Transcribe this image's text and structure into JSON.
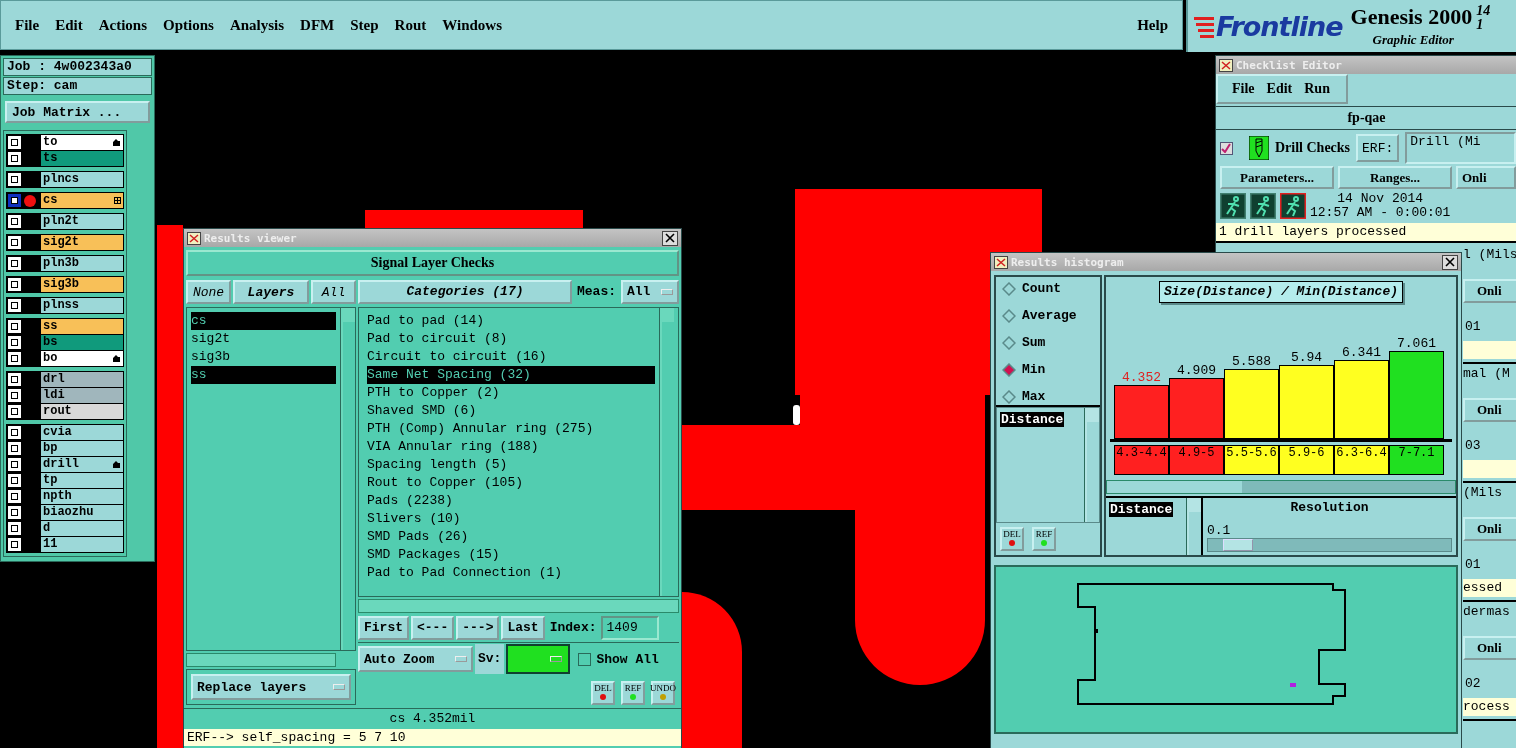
{
  "menu_bar": {
    "items": [
      "File",
      "Edit",
      "Actions",
      "Options",
      "Analysis",
      "DFM",
      "Step",
      "Rout",
      "Windows"
    ],
    "help": "Help"
  },
  "logo": {
    "brand": "Frontline",
    "product": "Genesis 2000",
    "version": "14",
    "version_line2": "1",
    "subtitle": "Graphic Editor"
  },
  "job_panel": {
    "job": "Job : 4w002343a0",
    "step": "Step: cam",
    "matrix_button": "Job Matrix ...",
    "layer_groups": [
      {
        "layers": [
          {
            "name": "to",
            "color": "#ffffff",
            "work_layer": false,
            "pointer_mark": true
          },
          {
            "name": "ts",
            "color": "#109a7c",
            "work_layer": false
          }
        ]
      },
      {
        "layers": [
          {
            "name": "plncs",
            "color": "#9cd8d8",
            "work_layer": false
          }
        ]
      },
      {
        "layers": [
          {
            "name": "cs",
            "color": "#f8c058",
            "work_layer": true,
            "grid_mark": true
          }
        ]
      },
      {
        "layers": [
          {
            "name": "pln2t",
            "color": "#9cd8d8",
            "work_layer": false
          }
        ]
      },
      {
        "layers": [
          {
            "name": "sig2t",
            "color": "#f8c058",
            "work_layer": false
          }
        ]
      },
      {
        "layers": [
          {
            "name": "pln3b",
            "color": "#9cd8d8",
            "work_layer": false
          }
        ]
      },
      {
        "layers": [
          {
            "name": "sig3b",
            "color": "#f8c058",
            "work_layer": false
          }
        ]
      },
      {
        "layers": [
          {
            "name": "plnss",
            "color": "#9cd8d8",
            "work_layer": false
          }
        ]
      },
      {
        "layers": [
          {
            "name": "ss",
            "color": "#f8c058",
            "work_layer": false
          },
          {
            "name": "bs",
            "color": "#109a7c",
            "work_layer": false
          },
          {
            "name": "bo",
            "color": "#ffffff",
            "work_layer": false,
            "pointer_mark": true
          }
        ]
      },
      {
        "layers": [
          {
            "name": "drl",
            "color": "#a0b6bc",
            "work_layer": false
          },
          {
            "name": "ldi",
            "color": "#a0b6bc",
            "work_layer": false
          },
          {
            "name": "rout",
            "color": "#d8d8d8",
            "work_layer": false
          }
        ]
      },
      {
        "layers": [
          {
            "name": "cvia",
            "color": "#9cd8d8",
            "work_layer": false
          },
          {
            "name": "bp",
            "color": "#9cd8d8",
            "work_layer": false
          },
          {
            "name": "drill",
            "color": "#9cd8d8",
            "work_layer": false,
            "pointer_mark": true
          },
          {
            "name": "tp",
            "color": "#9cd8d8",
            "work_layer": false
          },
          {
            "name": "npth",
            "color": "#9cd8d8",
            "work_layer": false
          },
          {
            "name": "biaozhu",
            "color": "#9cd8d8",
            "work_layer": false
          },
          {
            "name": "d",
            "color": "#9cd8d8",
            "work_layer": false
          },
          {
            "name": "11",
            "color": "#9cd8d8",
            "work_layer": false
          }
        ]
      }
    ]
  },
  "results_viewer": {
    "title": "Results viewer",
    "header": "Signal Layer Checks",
    "none_button": "None",
    "layers_button": "Layers",
    "all_button": "All",
    "layers": [
      {
        "name": "cs",
        "selected": true
      },
      {
        "name": "sig2t",
        "selected": false
      },
      {
        "name": "sig3b",
        "selected": false
      },
      {
        "name": "ss",
        "selected": true
      }
    ],
    "categories_button": "Categories (17)",
    "meas_label": "Meas:",
    "meas_value": "All",
    "categories": [
      {
        "name": "Pad to pad (14)",
        "selected": false
      },
      {
        "name": "Pad to circuit (8)",
        "selected": false
      },
      {
        "name": "Circuit to circuit (16)",
        "selected": false
      },
      {
        "name": "Same Net Spacing (32)",
        "selected": true
      },
      {
        "name": "PTH to Copper (2)",
        "selected": false
      },
      {
        "name": "Shaved SMD (6)",
        "selected": false
      },
      {
        "name": "PTH (Comp) Annular ring (275)",
        "selected": false
      },
      {
        "name": "VIA Annular ring (188)",
        "selected": false
      },
      {
        "name": "Spacing length (5)",
        "selected": false
      },
      {
        "name": "Rout to Copper (105)",
        "selected": false
      },
      {
        "name": "Pads (2238)",
        "selected": false
      },
      {
        "name": "Slivers (10)",
        "selected": false
      },
      {
        "name": "SMD Pads (26)",
        "selected": false
      },
      {
        "name": "SMD Packages (15)",
        "selected": false
      },
      {
        "name": "Pad to Pad Connection (1)",
        "selected": false
      }
    ],
    "nav_buttons": [
      "First",
      "<---",
      "--->",
      "Last"
    ],
    "index_label": "Index:",
    "index_value": "1409",
    "zoom_mode": "Auto Zoom",
    "sv_label": "Sv:",
    "sv": {
      "color": "#20e020"
    },
    "show_all": {
      "label": "Show All",
      "checked": false
    },
    "replace_mode": "Replace layers",
    "action_buttons": [
      "DEL",
      "REF",
      "UNDO"
    ],
    "status": "cs 4.352mil",
    "erf_line": "ERF--> self_spacing = 5 7 10"
  },
  "histogram": {
    "title": "Results histogram",
    "modes": [
      {
        "label": "Count",
        "selected": false
      },
      {
        "label": "Average",
        "selected": false
      },
      {
        "label": "Sum",
        "selected": false
      },
      {
        "label": "Min",
        "selected": true
      },
      {
        "label": "Max",
        "selected": false
      }
    ],
    "attributes": [
      {
        "name": "Distance",
        "selected": true
      }
    ],
    "action_buttons": [
      "DEL",
      "REF"
    ],
    "chart_data": {
      "type": "bar",
      "title": "Size(Distance) / Min(Distance)",
      "categories": [
        "4.3-4.4",
        "4.9-5",
        "5.5-5.6",
        "5.9-6",
        "6.3-6.4",
        "7-7.1"
      ],
      "values": [
        4.352,
        4.909,
        5.588,
        5.94,
        6.341,
        7.061
      ],
      "colors": [
        "#ff2020",
        "#ff2020",
        "#ffff20",
        "#ffff20",
        "#ffff20",
        "#20e020"
      ],
      "data_labels": true
    },
    "highlighted_labels": [
      true,
      false,
      false,
      false,
      false,
      false
    ],
    "group_list": [
      {
        "name": "Distance",
        "selected": true
      }
    ],
    "resolution_label": "Resolution",
    "resolution_value": "0.1",
    "resolution_slider": {
      "level": 0.06
    }
  },
  "checklist_editor": {
    "title": "Checklist Editor",
    "menu": [
      "File",
      "Edit",
      "Run"
    ],
    "name": "fp-qae",
    "check": {
      "checked": true,
      "name": "Drill Checks",
      "erf_label": "ERF:",
      "erf_value": "Drill (Mi",
      "buttons": [
        "Parameters...",
        "Ranges...",
        "Onli"
      ],
      "date": "14 Nov 2014",
      "time": "12:57 AM - 0:00:01",
      "status": "1 drill layers processed"
    },
    "partial_checks": [
      {
        "erf_value": "l (Mils",
        "button": "Onli",
        "time": "01"
      },
      {
        "erf_value": "mal (M",
        "button": "Onli",
        "time": "03"
      },
      {
        "erf_value": "(Mils",
        "button": "Onli",
        "time": "01",
        "status": "essed"
      },
      {
        "erf_value": "dermas",
        "button": "Onli",
        "time": "02",
        "status": "rocess"
      }
    ]
  }
}
